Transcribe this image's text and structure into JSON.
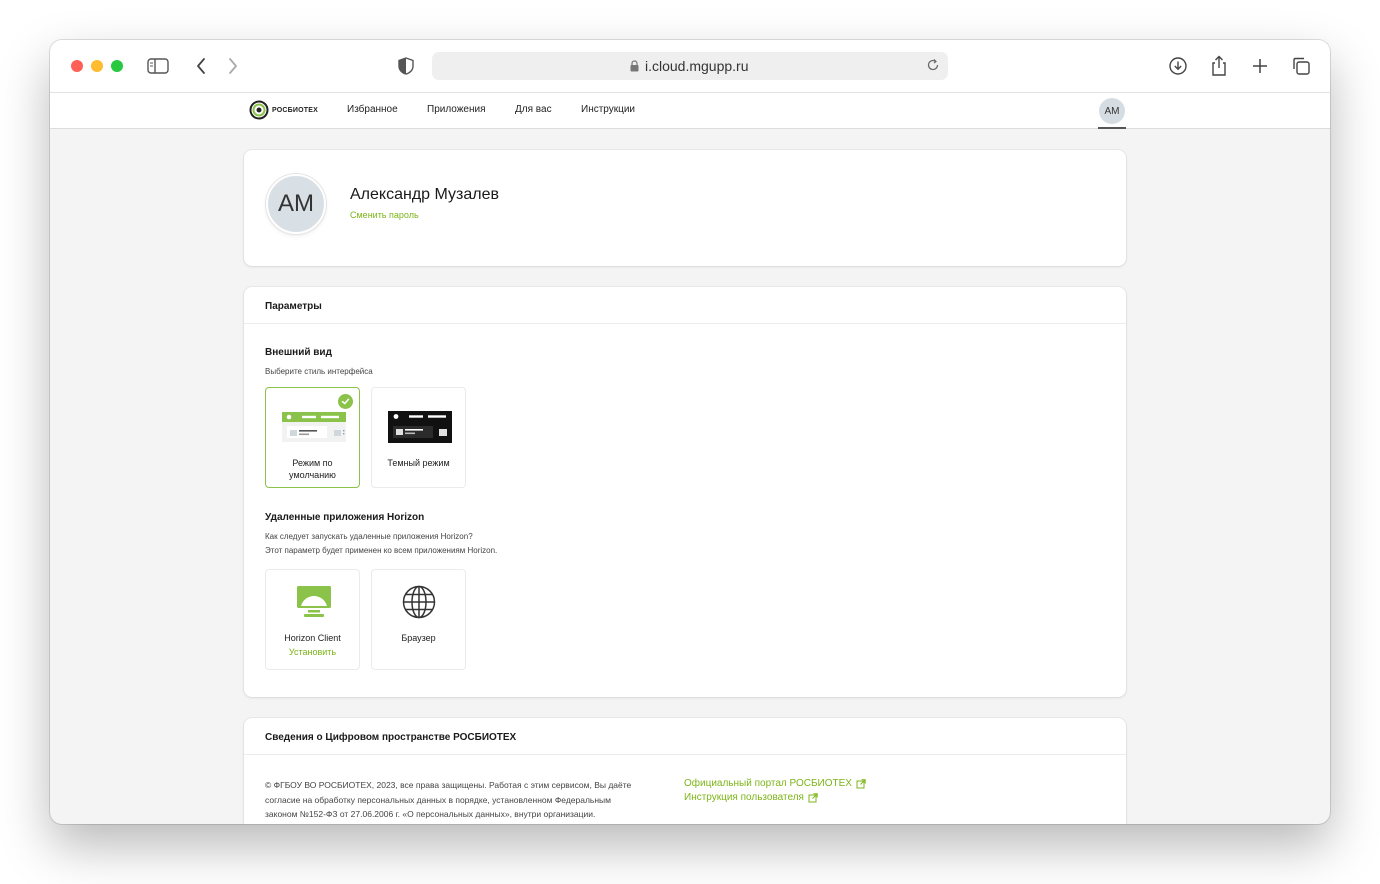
{
  "browser": {
    "url": "i.cloud.mgupp.ru"
  },
  "header": {
    "logo_text": "РОСБИОТЕХ",
    "nav": [
      {
        "label": "Избранное"
      },
      {
        "label": "Приложения"
      },
      {
        "label": "Для вас"
      },
      {
        "label": "Инструкции"
      }
    ],
    "avatar_initials": "AM"
  },
  "profile": {
    "initials": "AM",
    "name": "Александр Музалев",
    "change_password": "Сменить пароль"
  },
  "params": {
    "title": "Параметры",
    "appearance": {
      "title": "Внешний вид",
      "desc": "Выберите стиль интерфейса",
      "options": [
        {
          "label_line1": "Режим по",
          "label_line2": "умолчанию",
          "selected": true
        },
        {
          "label_line1": "Темный режим",
          "selected": false
        }
      ]
    },
    "horizon": {
      "title": "Удаленные приложения Horizon",
      "desc_line1": "Как следует запускать удаленные приложения Horizon?",
      "desc_line2": "Этот параметр будет применен ко всем приложениям Horizon.",
      "options": [
        {
          "label": "Horizon Client",
          "action": "Установить"
        },
        {
          "label": "Браузер"
        }
      ]
    }
  },
  "info": {
    "title": "Сведения о Цифровом пространстве РОСБИОТЕХ",
    "text_line1": "© ФГБОУ ВО РОСБИОТЕХ, 2023, все права защищены. Работая с этим сервисом, Вы даёте",
    "text_line2": "согласие на обработку персональных данных в порядке, установленном Федеральным",
    "text_line3": "законом №152-ФЗ от 27.06.2006 г. «О персональных данных», внутри организации.",
    "links": [
      {
        "label": "Официальный портал РОСБИОТЕХ"
      },
      {
        "label": "Инструкция пользователя"
      }
    ]
  },
  "colors": {
    "accent": "#8bc34a",
    "link": "#7cb518",
    "background": "#f4f4f4"
  }
}
